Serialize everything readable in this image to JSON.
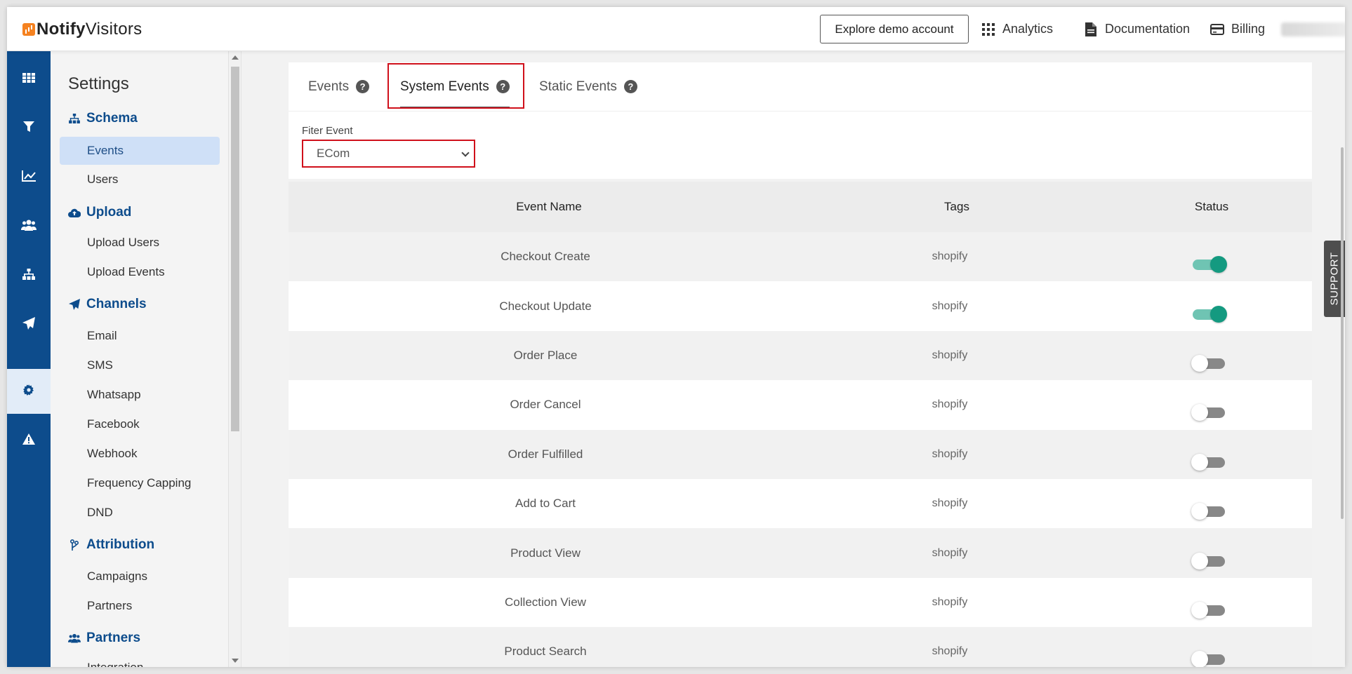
{
  "header": {
    "logo_bold": "Notify",
    "logo_rest": "Visitors",
    "explore_label": "Explore demo account",
    "nav": [
      {
        "label": "Analytics",
        "icon": "grid-icon"
      },
      {
        "label": "Documentation",
        "icon": "document-icon"
      },
      {
        "label": "Billing",
        "icon": "card-icon"
      }
    ]
  },
  "rail": [
    "dashboard-icon",
    "funnel-icon",
    "chart-icon",
    "users-icon",
    "sitemap-icon",
    "send-icon",
    "gear-icon",
    "alert-icon"
  ],
  "sidebar": {
    "title": "Settings",
    "sections": {
      "schema": "Schema",
      "upload": "Upload",
      "channels": "Channels",
      "attribution": "Attribution",
      "partners": "Partners"
    },
    "items": {
      "events": "Events",
      "users": "Users",
      "upload_users": "Upload Users",
      "upload_events": "Upload Events",
      "email": "Email",
      "sms": "SMS",
      "whatsapp": "Whatsapp",
      "facebook": "Facebook",
      "webhook": "Webhook",
      "frequency_capping": "Frequency Capping",
      "dnd": "DND",
      "campaigns": "Campaigns",
      "partners": "Partners",
      "integration": "Integration"
    }
  },
  "tabs": [
    {
      "label": "Events"
    },
    {
      "label": "System Events"
    },
    {
      "label": "Static Events"
    }
  ],
  "filter": {
    "label": "Fiter Event",
    "value": "ECom"
  },
  "table": {
    "headers": {
      "name": "Event Name",
      "tags": "Tags",
      "status": "Status"
    },
    "rows": [
      {
        "name": "Checkout Create",
        "tag": "shopify",
        "on": true
      },
      {
        "name": "Checkout Update",
        "tag": "shopify",
        "on": true
      },
      {
        "name": "Order Place",
        "tag": "shopify",
        "on": false
      },
      {
        "name": "Order Cancel",
        "tag": "shopify",
        "on": false
      },
      {
        "name": "Order Fulfilled",
        "tag": "shopify",
        "on": false
      },
      {
        "name": "Add to Cart",
        "tag": "shopify",
        "on": false
      },
      {
        "name": "Product View",
        "tag": "shopify",
        "on": false
      },
      {
        "name": "Collection View",
        "tag": "shopify",
        "on": false
      },
      {
        "name": "Product Search",
        "tag": "shopify",
        "on": false
      }
    ]
  },
  "support_label": "SUPPORT",
  "colors": {
    "brand_blue": "#0d4c8c",
    "highlight_red": "#d0101b",
    "toggle_on": "#149a80"
  }
}
